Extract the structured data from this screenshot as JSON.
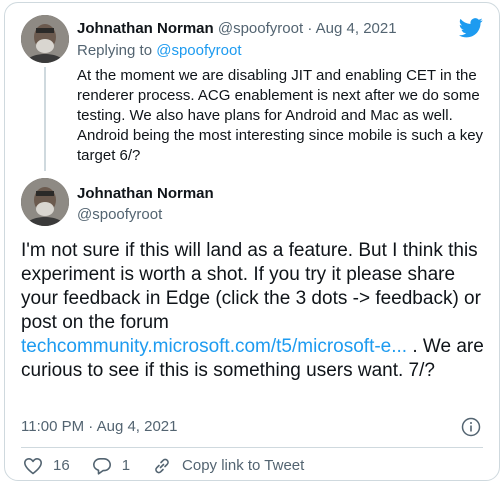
{
  "reply": {
    "name": "Johnathan Norman",
    "handle": "@spoofyroot",
    "separator": "·",
    "date": "Aug 4, 2021",
    "replying_prefix": "Replying to",
    "replying_to": "@spoofyroot",
    "text": "At the moment we are disabling JIT and enabling CET in the renderer process. ACG enablement is next after we do some testing. We also have plans for Android and Mac as well. Android being the most interesting since mobile is such a key target 6/?"
  },
  "tweet": {
    "name": "Johnathan Norman",
    "handle": "@spoofyroot",
    "text_before_link": "I'm not sure if this will land as a feature. But I think this experiment is worth a shot. If you try it please share your feedback in Edge (click the 3 dots -> feedback) or post on the forum",
    "link": "techcommunity.microsoft.com/t5/microsoft-e...",
    "text_after_link": " . We are curious to see if this is something users want. 7/?",
    "time": "11:00 PM · Aug 4, 2021"
  },
  "actions": {
    "likes": "16",
    "replies": "1",
    "copy_link": "Copy link to Tweet"
  },
  "icons": {
    "brand": "twitter-bird-icon",
    "info": "info-icon",
    "like": "heart-icon",
    "reply": "reply-bubble-icon",
    "copy": "link-icon"
  },
  "colors": {
    "brand": "#1d9bf0",
    "text": "#0f1419",
    "muted": "#536471",
    "border": "#cfd9de"
  }
}
